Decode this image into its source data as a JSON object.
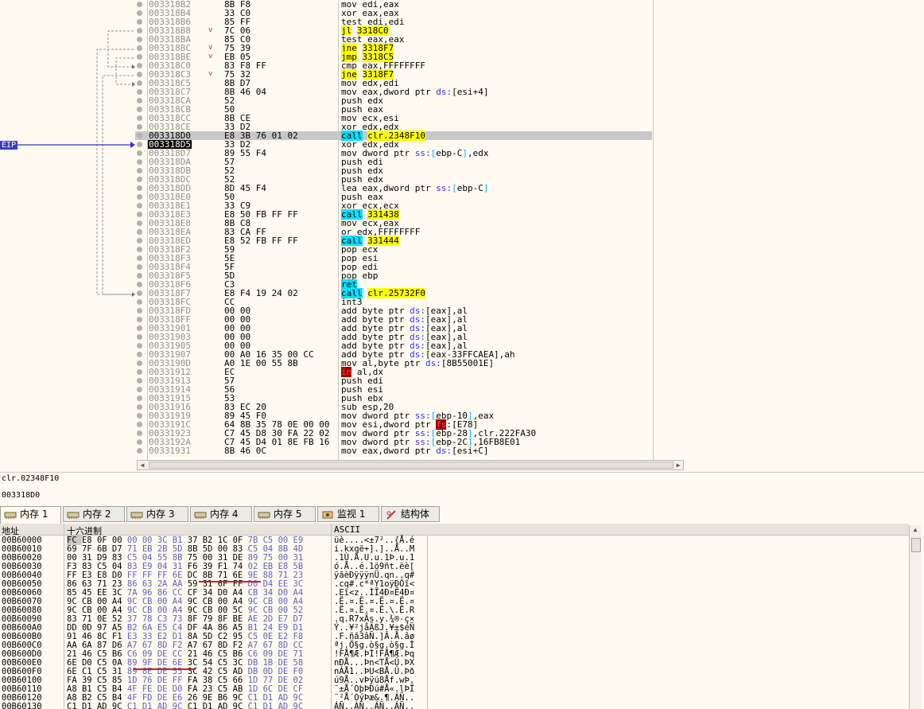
{
  "eip_label": "EIP",
  "disasm": [
    {
      "addr": "003318B2",
      "bytes": "8B F8",
      "instr": [
        [
          "mov edi,eax",
          ""
        ]
      ]
    },
    {
      "addr": "003318B4",
      "bytes": "33 C0",
      "instr": [
        [
          "xor eax,eax",
          ""
        ]
      ]
    },
    {
      "addr": "003318B6",
      "bytes": "85 FF",
      "instr": [
        [
          "test edi,edi",
          ""
        ]
      ]
    },
    {
      "addr": "003318B8",
      "arrow": "v",
      "bytes": "7C 06",
      "instr": [
        [
          "jl",
          "yel"
        ],
        [
          " ",
          ""
        ],
        [
          "3318C0",
          "yel"
        ]
      ]
    },
    {
      "addr": "003318BA",
      "bytes": "85 C0",
      "instr": [
        [
          "test eax,eax",
          ""
        ]
      ]
    },
    {
      "addr": "003318BC",
      "arrow": "v",
      "bytes": "75 39",
      "instr": [
        [
          "jne",
          "yel"
        ],
        [
          " ",
          ""
        ],
        [
          "3318F7",
          "yel"
        ]
      ]
    },
    {
      "addr": "003318BE",
      "arrow": "v",
      "bytes": "EB 05",
      "instr": [
        [
          "jmp",
          "yel"
        ],
        [
          " ",
          ""
        ],
        [
          "3318C5",
          "yel"
        ]
      ]
    },
    {
      "addr": "003318C0",
      "bytes": "83 F8 FF",
      "instr": [
        [
          "cmp eax,FFFFFFFF",
          ""
        ]
      ]
    },
    {
      "addr": "003318C3",
      "arrow": "v",
      "bytes": "75 32",
      "instr": [
        [
          "jne",
          "yel"
        ],
        [
          " ",
          ""
        ],
        [
          "3318F7",
          "yel"
        ]
      ]
    },
    {
      "addr": "003318C5",
      "bytes": "8B D7",
      "instr": [
        [
          "mov edx,edi",
          ""
        ]
      ]
    },
    {
      "addr": "003318C7",
      "bytes": "8B 46 04",
      "instr": [
        [
          "mov eax,dword ptr ",
          ""
        ],
        [
          "ds:",
          "seg"
        ],
        [
          "[esi+4]",
          ""
        ]
      ]
    },
    {
      "addr": "003318CA",
      "bytes": "52",
      "instr": [
        [
          "push edx",
          ""
        ]
      ]
    },
    {
      "addr": "003318CB",
      "bytes": "50",
      "instr": [
        [
          "push eax",
          ""
        ]
      ]
    },
    {
      "addr": "003318CC",
      "bytes": "8B CE",
      "instr": [
        [
          "mov ecx,esi",
          ""
        ]
      ]
    },
    {
      "addr": "003318CE",
      "bytes": "33 D2",
      "instr": [
        [
          "xor edx,edx",
          ""
        ]
      ]
    },
    {
      "addr": "003318D0",
      "bytes": "E8 3B 76 01 02",
      "instr": [
        [
          "call",
          "cyan"
        ],
        [
          " ",
          ""
        ],
        [
          "clr.2348F10",
          "yel"
        ]
      ],
      "sel": true
    },
    {
      "addr": "003318D5",
      "bytes": "33 D2",
      "instr": [
        [
          "xor edx,edx",
          ""
        ]
      ],
      "cur": true
    },
    {
      "addr": "003318D7",
      "bytes": "89 55 F4",
      "instr": [
        [
          "mov dword ptr ",
          ""
        ],
        [
          "ss:",
          "seg"
        ],
        [
          "[",
          "brk"
        ],
        [
          "ebp-C",
          ""
        ],
        [
          "]",
          "brk"
        ],
        [
          ",edx",
          ""
        ]
      ]
    },
    {
      "addr": "003318DA",
      "bytes": "57",
      "instr": [
        [
          "push edi",
          ""
        ]
      ]
    },
    {
      "addr": "003318DB",
      "bytes": "52",
      "instr": [
        [
          "push edx",
          ""
        ]
      ]
    },
    {
      "addr": "003318DC",
      "bytes": "52",
      "instr": [
        [
          "push edx",
          ""
        ]
      ]
    },
    {
      "addr": "003318DD",
      "bytes": "8D 45 F4",
      "instr": [
        [
          "lea eax,dword ptr ",
          ""
        ],
        [
          "ss:",
          "seg"
        ],
        [
          "[",
          "brk"
        ],
        [
          "ebp-C",
          ""
        ],
        [
          "]",
          "brk"
        ]
      ]
    },
    {
      "addr": "003318E0",
      "bytes": "50",
      "instr": [
        [
          "push eax",
          ""
        ]
      ]
    },
    {
      "addr": "003318E1",
      "bytes": "33 C9",
      "instr": [
        [
          "xor ecx,ecx",
          ""
        ]
      ]
    },
    {
      "addr": "003318E3",
      "bytes": "E8 50 FB FF FF",
      "instr": [
        [
          "call",
          "cyan"
        ],
        [
          " ",
          ""
        ],
        [
          "331438",
          "yel"
        ]
      ]
    },
    {
      "addr": "003318E8",
      "bytes": "8B C8",
      "instr": [
        [
          "mov ecx,eax",
          ""
        ]
      ]
    },
    {
      "addr": "003318EA",
      "bytes": "83 CA FF",
      "instr": [
        [
          "or edx,FFFFFFFF",
          ""
        ]
      ]
    },
    {
      "addr": "003318ED",
      "bytes": "E8 52 FB FF FF",
      "instr": [
        [
          "call",
          "cyan"
        ],
        [
          " ",
          ""
        ],
        [
          "331444",
          "yel"
        ]
      ]
    },
    {
      "addr": "003318F2",
      "bytes": "59",
      "instr": [
        [
          "pop ecx",
          ""
        ]
      ]
    },
    {
      "addr": "003318F3",
      "bytes": "5E",
      "instr": [
        [
          "pop esi",
          ""
        ]
      ]
    },
    {
      "addr": "003318F4",
      "bytes": "5F",
      "instr": [
        [
          "pop edi",
          ""
        ]
      ]
    },
    {
      "addr": "003318F5",
      "bytes": "5D",
      "instr": [
        [
          "pop ebp",
          ""
        ]
      ]
    },
    {
      "addr": "003318F6",
      "bytes": "C3",
      "instr": [
        [
          "ret",
          "cyan"
        ]
      ]
    },
    {
      "addr": "003318F7",
      "bytes": "E8 F4 19 24 02",
      "instr": [
        [
          "call",
          "cyan"
        ],
        [
          " ",
          ""
        ],
        [
          "clr.25732F0",
          "yel"
        ]
      ]
    },
    {
      "addr": "003318FC",
      "bytes": "CC",
      "instr": [
        [
          "int3",
          ""
        ]
      ]
    },
    {
      "addr": "003318FD",
      "bytes": "00 00",
      "instr": [
        [
          "add byte ptr ",
          ""
        ],
        [
          "ds:",
          "seg"
        ],
        [
          "[eax],al",
          ""
        ]
      ]
    },
    {
      "addr": "003318FF",
      "bytes": "00 00",
      "instr": [
        [
          "add byte ptr ",
          ""
        ],
        [
          "ds:",
          "seg"
        ],
        [
          "[eax],al",
          ""
        ]
      ]
    },
    {
      "addr": "00331901",
      "bytes": "00 00",
      "instr": [
        [
          "add byte ptr ",
          ""
        ],
        [
          "ds:",
          "seg"
        ],
        [
          "[eax],al",
          ""
        ]
      ]
    },
    {
      "addr": "00331903",
      "bytes": "00 00",
      "instr": [
        [
          "add byte ptr ",
          ""
        ],
        [
          "ds:",
          "seg"
        ],
        [
          "[eax],al",
          ""
        ]
      ]
    },
    {
      "addr": "00331905",
      "bytes": "00 00",
      "instr": [
        [
          "add byte ptr ",
          ""
        ],
        [
          "ds:",
          "seg"
        ],
        [
          "[eax],al",
          ""
        ]
      ]
    },
    {
      "addr": "00331907",
      "bytes": "00 A0 16 35 00 CC",
      "instr": [
        [
          "add byte ptr ",
          ""
        ],
        [
          "ds:",
          "seg"
        ],
        [
          "[eax-33FFCAEA],ah",
          ""
        ]
      ]
    },
    {
      "addr": "0033190D",
      "bytes": "A0 1E 00 55 8B",
      "instr": [
        [
          "mov al,byte ptr ",
          ""
        ],
        [
          "ds:",
          "seg"
        ],
        [
          "[8B55001E]",
          ""
        ]
      ]
    },
    {
      "addr": "00331912",
      "bytes": "EC",
      "instr": [
        [
          "in",
          "red"
        ],
        [
          " al,dx",
          ""
        ]
      ]
    },
    {
      "addr": "00331913",
      "bytes": "57",
      "instr": [
        [
          "push edi",
          ""
        ]
      ]
    },
    {
      "addr": "00331914",
      "bytes": "56",
      "instr": [
        [
          "push esi",
          ""
        ]
      ]
    },
    {
      "addr": "00331915",
      "bytes": "53",
      "instr": [
        [
          "push ebx",
          ""
        ]
      ]
    },
    {
      "addr": "00331916",
      "bytes": "83 EC 20",
      "instr": [
        [
          "sub esp,20",
          ""
        ]
      ]
    },
    {
      "addr": "00331919",
      "bytes": "89 45 F0",
      "instr": [
        [
          "mov dword ptr ",
          ""
        ],
        [
          "ss:",
          "seg"
        ],
        [
          "[",
          "brk"
        ],
        [
          "ebp-10",
          ""
        ],
        [
          "]",
          "brk"
        ],
        [
          ",eax",
          ""
        ]
      ]
    },
    {
      "addr": "0033191C",
      "bytes": "64 8B 35 78 0E 00 00",
      "instr": [
        [
          "mov esi,dword ptr ",
          ""
        ],
        [
          "fs",
          "red"
        ],
        [
          ":[E78]",
          ""
        ]
      ]
    },
    {
      "addr": "00331923",
      "bytes": "C7 45 D8 30 FA 22 02",
      "instr": [
        [
          "mov dword ptr ",
          ""
        ],
        [
          "ss:",
          "seg"
        ],
        [
          "[",
          "brk"
        ],
        [
          "ebp-28",
          ""
        ],
        [
          "]",
          "brk"
        ],
        [
          ",clr.222FA30",
          ""
        ]
      ]
    },
    {
      "addr": "0033192A",
      "bytes": "C7 45 D4 01 8E FB 16",
      "instr": [
        [
          "mov dword ptr ",
          ""
        ],
        [
          "ss:",
          "seg"
        ],
        [
          "[",
          "brk"
        ],
        [
          "ebp-2C",
          ""
        ],
        [
          "]",
          "brk"
        ],
        [
          ",16FB8E01",
          ""
        ]
      ]
    },
    {
      "addr": "00331931",
      "bytes": "8B 46 0C",
      "instr": [
        [
          "mov eax,dword ptr ",
          ""
        ],
        [
          "ds:",
          "seg"
        ],
        [
          "[esi+C]",
          ""
        ]
      ]
    }
  ],
  "info": {
    "line1": "clr.02348F10",
    "line2": "003318D0"
  },
  "tabs": [
    {
      "label": "内存 1",
      "active": true
    },
    {
      "label": "内存 2"
    },
    {
      "label": "内存 3"
    },
    {
      "label": "内存 4"
    },
    {
      "label": "内存 5"
    },
    {
      "label": "监视 1"
    },
    {
      "label": "结构体"
    }
  ],
  "dump_headers": {
    "addr": "地址",
    "hex": "十六进制",
    "ascii": "ASCII"
  },
  "dump": [
    {
      "addr": "00B60000",
      "hex": "FC E8 0F 00 00 00 3C B1 37 B2 1C 0F 7B C5 00 E9",
      "ascii": "üè....<±7²..{Å.é"
    },
    {
      "addr": "00B60010",
      "hex": "69 7F 6B D7 71 EB 2B 5D 8B 5D 00 83 C5 04 8B 4D",
      "ascii": "i.kxqë+].]..Å..M"
    },
    {
      "addr": "00B60020",
      "hex": "00 31 D9 83 C5 04 55 8B 75 00 31 DE 89 75 00 31",
      "ascii": ".1Ù.Å.U.u.1Þ.u.1"
    },
    {
      "addr": "00B60030",
      "hex": "F3 83 C5 04 83 E9 04 31 F6 39 F1 74 02 EB E8 5B",
      "ascii": "ó.Å..é.1ö9ñt.ëè["
    },
    {
      "addr": "00B60040",
      "hex": "FF E3 E8 D0 FF FF FF 6E DC 8B 71 6E 9E 88 71 23",
      "ascii": "ÿãèÐÿÿÿnÜ.qn..q#"
    },
    {
      "addr": "00B60050",
      "hex": "86 63 71 23 86 63 2A AA 59 31 6F FF D0 D4 EE 3C",
      "ascii": ".cq#.c*ªY1oÿÐÔî<"
    },
    {
      "addr": "00B60060",
      "hex": "85 45 EE 3C 7A 96 86 CC CF 34 D0 A4 CB 34 D0 A4",
      "ascii": ".Eî<z..ÌÏ4Ð¤Ë4Ð¤"
    },
    {
      "addr": "00B60070",
      "hex": "9C CB 00 A4 9C CB 00 A4 9C CB 00 A4 9C CB 00 A4",
      "ascii": ".Ë.¤.Ë.¤.Ë.¤.Ë.¤"
    },
    {
      "addr": "00B60080",
      "hex": "9C CB 00 A4 9C CB 00 A4 9C CB 00 5C 9C CB 00 52",
      "ascii": ".Ë.¤.Ë.¤.Ë.\\.Ë.R"
    },
    {
      "addr": "00B60090",
      "hex": "83 71 0E 52 37 78 C3 73 8F 79 8F BE AE 2D E7 D7",
      "ascii": ".q.R7xÃs.y.¾®-ç×"
    },
    {
      "addr": "00B600A0",
      "hex": "DD 0D 97 A5 B2 6A E5 C4 DF 4A 86 A5 B1 24 E9 D1",
      "ascii": "Ý..¥²jåÄßJ.¥±$éÑ"
    },
    {
      "addr": "00B600B0",
      "hex": "91 46 8C F1 E3 33 E2 D1 8A 5D C2 95 C5 0E E2 F8",
      "ascii": ".F.ñã3âÑ.]Â.Å.âø"
    },
    {
      "addr": "00B600C0",
      "hex": "AA 6A 87 D6 A7 67 8D F2 A7 67 8D F2 A7 67 8D CC",
      "ascii": "ªj.Ö§g.ò§g.ò§g.Ì"
    },
    {
      "addr": "00B600D0",
      "hex": "21 46 C5 B6 C6 09 DE CC 21 46 C5 B6 C6 09 DE 71",
      "ascii": "!FÅ¶Æ.ÞÌ!FÅ¶Æ.Þq"
    },
    {
      "addr": "00B600E0",
      "hex": "6E D0 C5 0A 89 9F DE 6E 3C 54 C5 3C DB 1B DE 58",
      "ascii": "nÐÅ...Þn<TÅ<Û.ÞX"
    },
    {
      "addr": "00B600F0",
      "hex": "6E C1 C5 31 89 8E DE 55 3C 42 C5 AD DB 0D DE F0",
      "ascii": "nÁÅ1..ÞU<BÅ.Û.Þð"
    },
    {
      "addr": "00B60100",
      "hex": "FA 39 C5 85 1D 76 DE FF FA 38 C5 66 1D 77 DE 02",
      "ascii": "ú9Å..vÞÿú8Åf.wÞ."
    },
    {
      "addr": "00B60110",
      "hex": "A8 B1 C5 B4 4F FE DE D0 FA 23 C5 AB 1D 6C DE CF",
      "ascii": "¨±Å´OþÞÐú#Å«.lÞÏ"
    },
    {
      "addr": "00B60120",
      "hex": "A8 B2 C5 B4 4F FD DE E6 26 9E B6 9C C1 D1 AD 9C",
      "ascii": "¨²Å´OýÞæ&.¶.ÁÑ.."
    },
    {
      "addr": "00B60130",
      "hex": "C1 D1 AD 9C C1 D1 AD 9C C1 D1 AD 9C C1 D1 AD 9C",
      "ascii": "ÁÑ..ÁÑ..ÁÑ..ÁÑ.."
    }
  ]
}
